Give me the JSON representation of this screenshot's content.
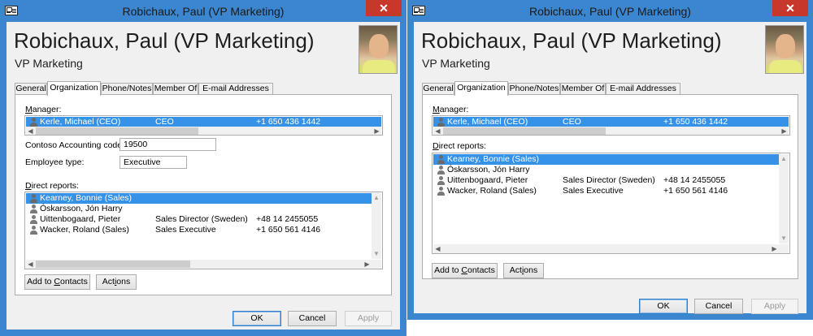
{
  "window_title": "Robichaux, Paul (VP Marketing)",
  "close_glyph": "✕",
  "contact": {
    "name": "Robichaux, Paul (VP Marketing)",
    "job_title": "VP Marketing"
  },
  "tabs": [
    {
      "label": "General"
    },
    {
      "label": "Organization"
    },
    {
      "label": "Phone/Notes"
    },
    {
      "label": "Member Of"
    },
    {
      "label": "E-mail Addresses"
    }
  ],
  "manager_label_first": "M",
  "manager_label_rest": "anager:",
  "manager": {
    "name": "Kerle, Michael (CEO)",
    "title": "CEO",
    "phone": "+1 650 436 1442"
  },
  "accounting_code_label": "Contoso Accounting code:",
  "accounting_code_value": "19500",
  "employee_type_label": "Employee type:",
  "employee_type_value": "Executive",
  "direct_reports_label_first": "D",
  "direct_reports_label_rest": "irect reports:",
  "direct_reports": [
    {
      "name": "Kearney, Bonnie (Sales)",
      "title": "",
      "phone": ""
    },
    {
      "name": "Óskarsson, Jón Harry",
      "title": "",
      "phone": ""
    },
    {
      "name": "Uittenbogaard, Pieter",
      "title": "Sales Director (Sweden)",
      "phone": "+48 14 2455055"
    },
    {
      "name": "Wacker, Roland (Sales)",
      "title": "Sales Executive",
      "phone": "+1 650 561 4146"
    }
  ],
  "buttons": {
    "add_to_contacts_a": "Add to ",
    "add_to_contacts_b": "C",
    "add_to_contacts_c": "ontacts",
    "actions_a": "Act",
    "actions_b": "i",
    "actions_c": "ons",
    "ok": "OK",
    "cancel": "Cancel",
    "apply": "Apply"
  },
  "colors": {
    "titlebar": "#3b86cf",
    "selection": "#3592e6",
    "close": "#c7382b"
  },
  "icons": [
    "app-icon",
    "close-icon",
    "person-icon",
    "contact-photo"
  ]
}
